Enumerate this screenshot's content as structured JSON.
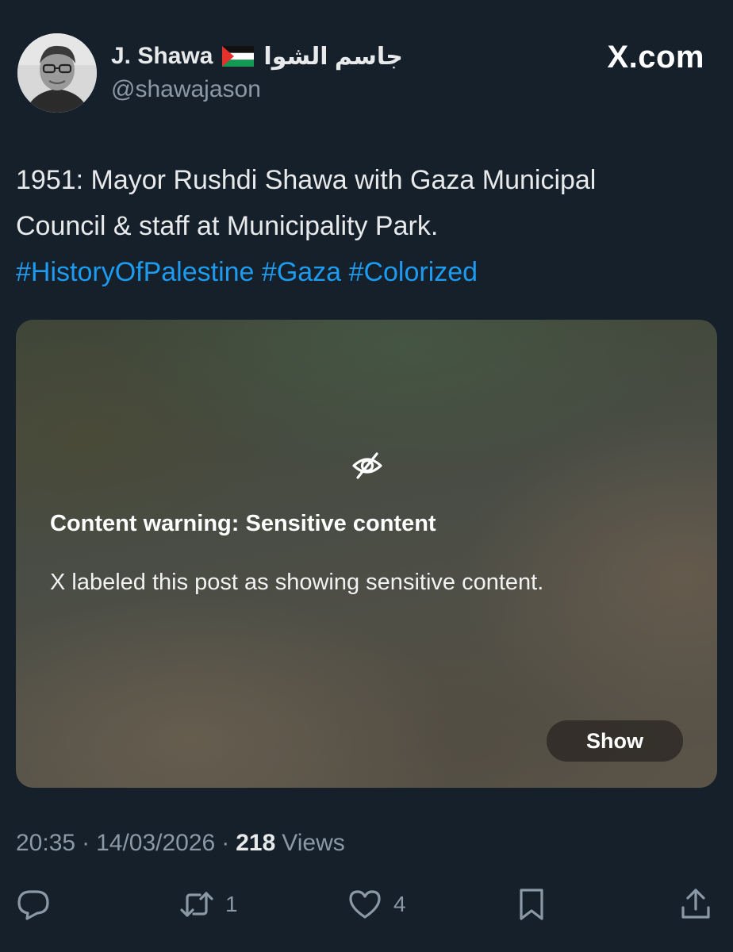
{
  "author": {
    "display_name": "J. Shawa",
    "arabic_name": "جاسم الشوا",
    "handle": "@shawajason",
    "flag_icon": "palestine-flag-icon"
  },
  "brand": {
    "label": "X.com"
  },
  "post": {
    "text_line_1": "1951: Mayor Rushdi Shawa with Gaza Municipal",
    "text_line_2": "Council & staff at Municipality Park.",
    "hashtags": [
      "#HistoryOfPalestine",
      "#Gaza",
      "#Colorized"
    ]
  },
  "media": {
    "icon": "eye-off-icon",
    "warning_title": "Content warning: Sensitive content",
    "warning_description": "X labeled this post as showing sensitive content.",
    "show_label": "Show"
  },
  "meta": {
    "time": "20:35",
    "date": "14/03/2026",
    "views_count": "218",
    "views_label": "Views",
    "separator": "·"
  },
  "actions": {
    "reply_count": "",
    "retweet_count": "1",
    "like_count": "4"
  },
  "colors": {
    "background": "#15202b",
    "hashtag": "#1d9bf0",
    "secondary_text": "#8b98a5"
  }
}
